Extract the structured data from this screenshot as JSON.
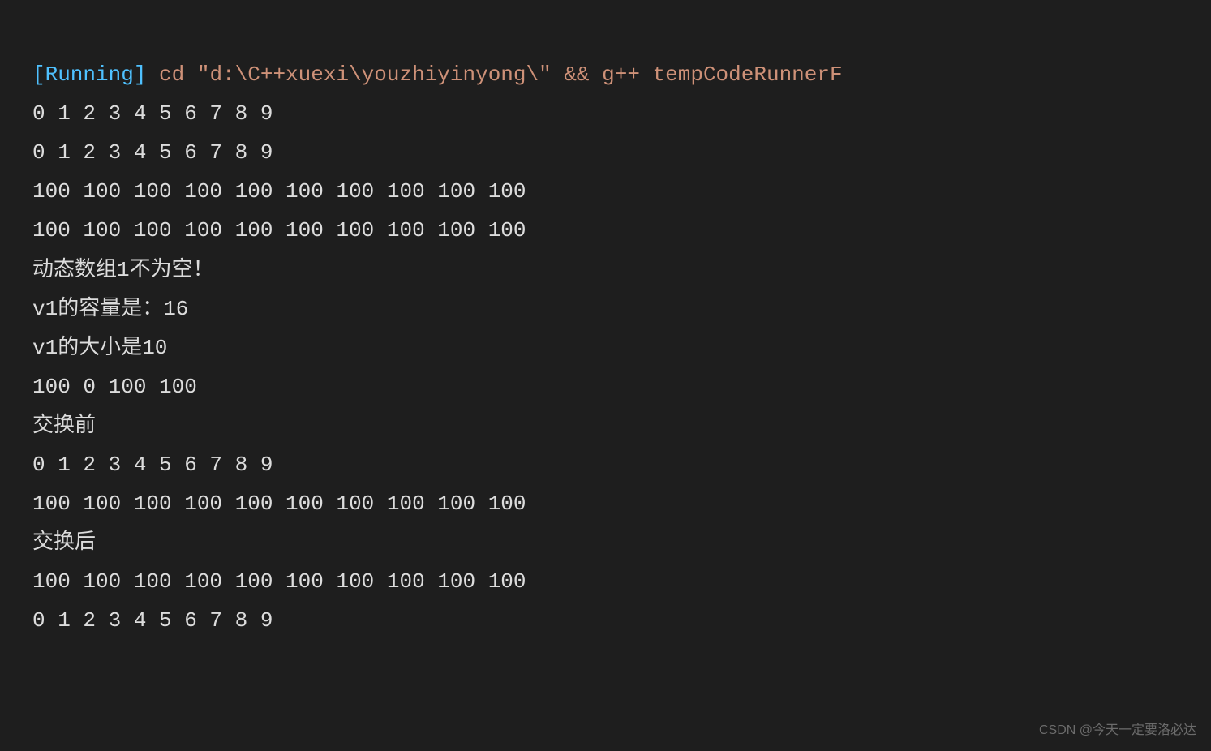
{
  "terminal": {
    "status_tag": "[Running]",
    "command": " cd \"d:\\C++xuexi\\youzhiyinyong\\\" && g++ tempCodeRunnerF",
    "lines": [
      "0 1 2 3 4 5 6 7 8 9 ",
      "0 1 2 3 4 5 6 7 8 9 ",
      "100 100 100 100 100 100 100 100 100 100",
      "100 100 100 100 100 100 100 100 100 100",
      "动态数组1不为空！",
      "v1的容量是：16",
      "v1的大小是10",
      "100 0 100 100 ",
      "交换前",
      "0 1 2 3 4 5 6 7 8 9 ",
      "100 100 100 100 100 100 100 100 100 100 ",
      "交换后",
      "100 100 100 100 100 100 100 100 100 100 ",
      "0 1 2 3 4 5 6 7 8 9 "
    ]
  },
  "watermark": "CSDN @今天一定要洛必达"
}
